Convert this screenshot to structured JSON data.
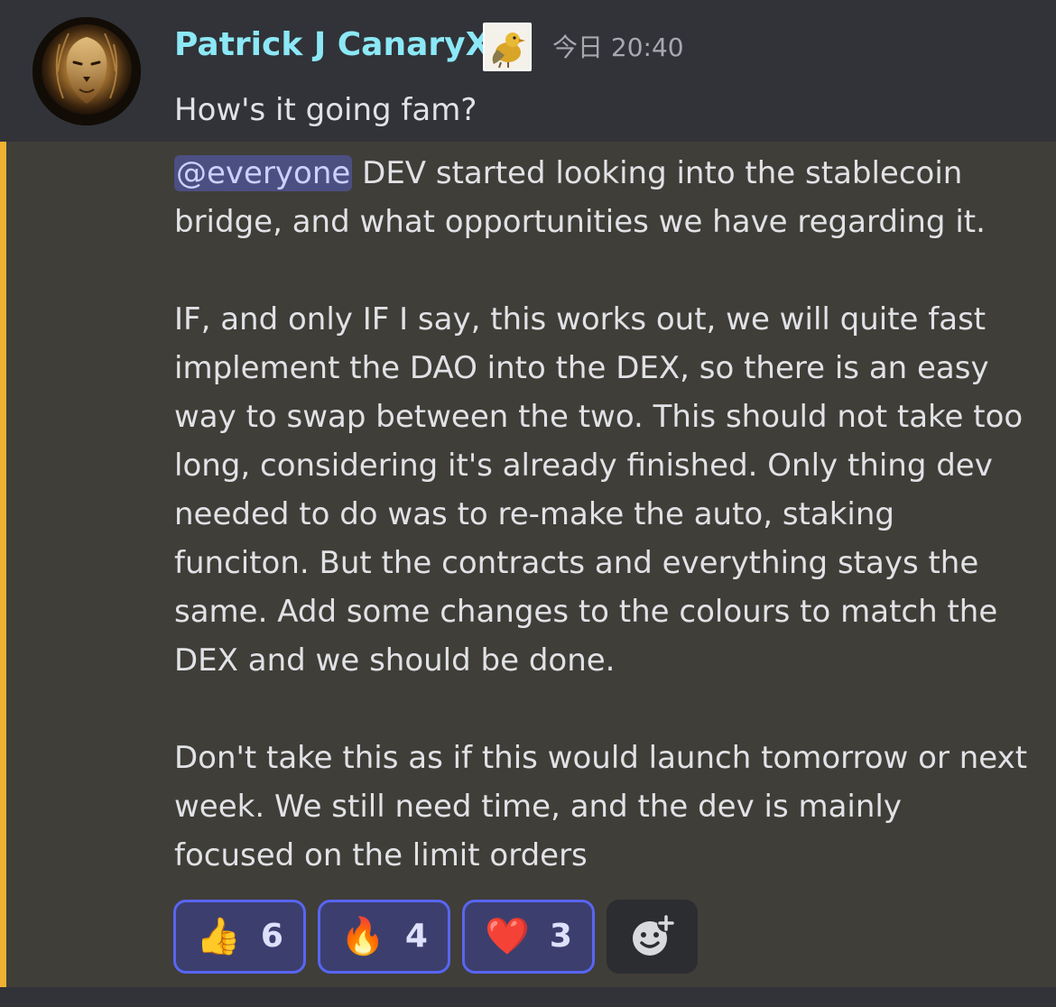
{
  "message": {
    "username": "Patrick J CanaryX",
    "timestamp": "今日 20:40",
    "first_line": "How's it going fam?",
    "mention": "@everyone",
    "mention_continuation": " DEV started looking into the stablecoin bridge, and what opportunities we have regarding it.",
    "paragraph_2": "IF, and only IF I say, this works out, we will quite fast implement the DAO into the DEX, so there is an easy way to swap between the two. This should not take too long, considering it's already finished. Only thing dev needed to do was to re-make the auto, staking funciton. But the contracts and everything stays the same. Add some changes to the colours to match the DEX and we should be done.",
    "paragraph_3": "Don't take this as if this would launch tomorrow or next week. We still need time, and the dev is mainly focused on the limit orders"
  },
  "reactions": [
    {
      "emoji": "👍",
      "count": "6"
    },
    {
      "emoji": "🔥",
      "count": "4"
    },
    {
      "emoji": "❤️",
      "count": "3"
    }
  ],
  "icons": {
    "avatar": "lion-avatar",
    "role": "canary-bird-icon",
    "add_reaction": "add-reaction-icon"
  },
  "colors": {
    "username": "#8ce8f6",
    "mention_bar": "#f0b232",
    "mention_bg": "#403e38",
    "reaction_border": "#5865f2"
  }
}
